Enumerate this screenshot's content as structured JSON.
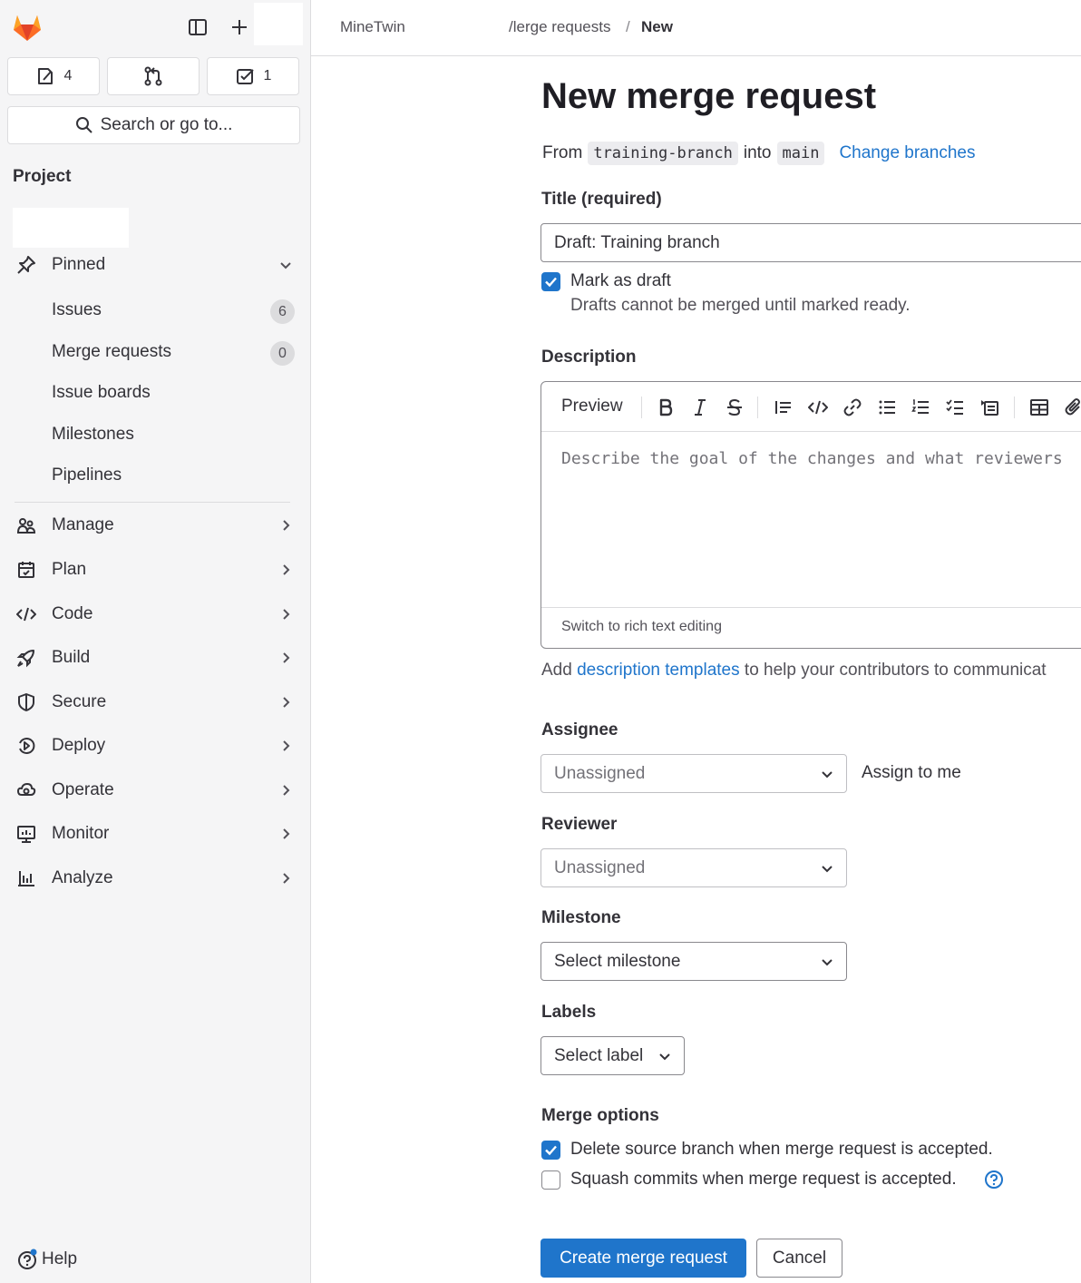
{
  "colors": {
    "accent": "#1f75cb",
    "sidebar_bg": "#f5f5f6",
    "logo_orange": "#e24329"
  },
  "sidebar": {
    "counters": [
      {
        "icon": "issues-icon",
        "count": "4"
      },
      {
        "icon": "merge-request-icon",
        "count": ""
      },
      {
        "icon": "todo-icon",
        "count": "1"
      }
    ],
    "search_label": "Search or go to...",
    "heading": "Project",
    "pinned": {
      "label": "Pinned",
      "items": [
        {
          "label": "Issues",
          "badge": "6"
        },
        {
          "label": "Merge requests",
          "badge": "0"
        },
        {
          "label": "Issue boards"
        },
        {
          "label": "Milestones"
        },
        {
          "label": "Pipelines"
        }
      ]
    },
    "sections": [
      {
        "label": "Manage",
        "icon": "users-icon"
      },
      {
        "label": "Plan",
        "icon": "calendar-icon"
      },
      {
        "label": "Code",
        "icon": "code-icon"
      },
      {
        "label": "Build",
        "icon": "rocket-icon"
      },
      {
        "label": "Secure",
        "icon": "shield-icon"
      },
      {
        "label": "Deploy",
        "icon": "deploy-icon"
      },
      {
        "label": "Operate",
        "icon": "cloud-icon"
      },
      {
        "label": "Monitor",
        "icon": "monitor-icon"
      },
      {
        "label": "Analyze",
        "icon": "chart-icon"
      }
    ],
    "help_label": "Help"
  },
  "breadcrumb": {
    "project": "MineTwin",
    "section": "/lerge requests",
    "separator": "/",
    "current": "New"
  },
  "main": {
    "title": "New merge request",
    "from_label": "From",
    "source_branch": "training-branch",
    "into_label": "into",
    "target_branch": "main",
    "change_branches": "Change branches",
    "title_label": "Title (required)",
    "title_value": "Draft: Training branch",
    "draft_label": "Mark as draft",
    "draft_help": "Drafts cannot be merged until marked ready.",
    "description_label": "Description",
    "preview_label": "Preview",
    "description_placeholder": "Describe the goal of the changes and what reviewers",
    "rich_text_toggle": "Switch to rich text editing",
    "templates_prefix": "Add",
    "templates_link": "description templates",
    "templates_suffix": "to help your contributors to communicat",
    "assignee_label": "Assignee",
    "assignee_value": "Unassigned",
    "assign_to_me": "Assign to me",
    "reviewer_label": "Reviewer",
    "reviewer_value": "Unassigned",
    "milestone_label": "Milestone",
    "milestone_value": "Select milestone",
    "labels_label": "Labels",
    "labels_value": "Select label",
    "merge_options_label": "Merge options",
    "delete_branch_label": "Delete source branch when merge request is accepted.",
    "squash_label": "Squash commits when merge request is accepted.",
    "create_button": "Create merge request",
    "cancel_button": "Cancel"
  }
}
